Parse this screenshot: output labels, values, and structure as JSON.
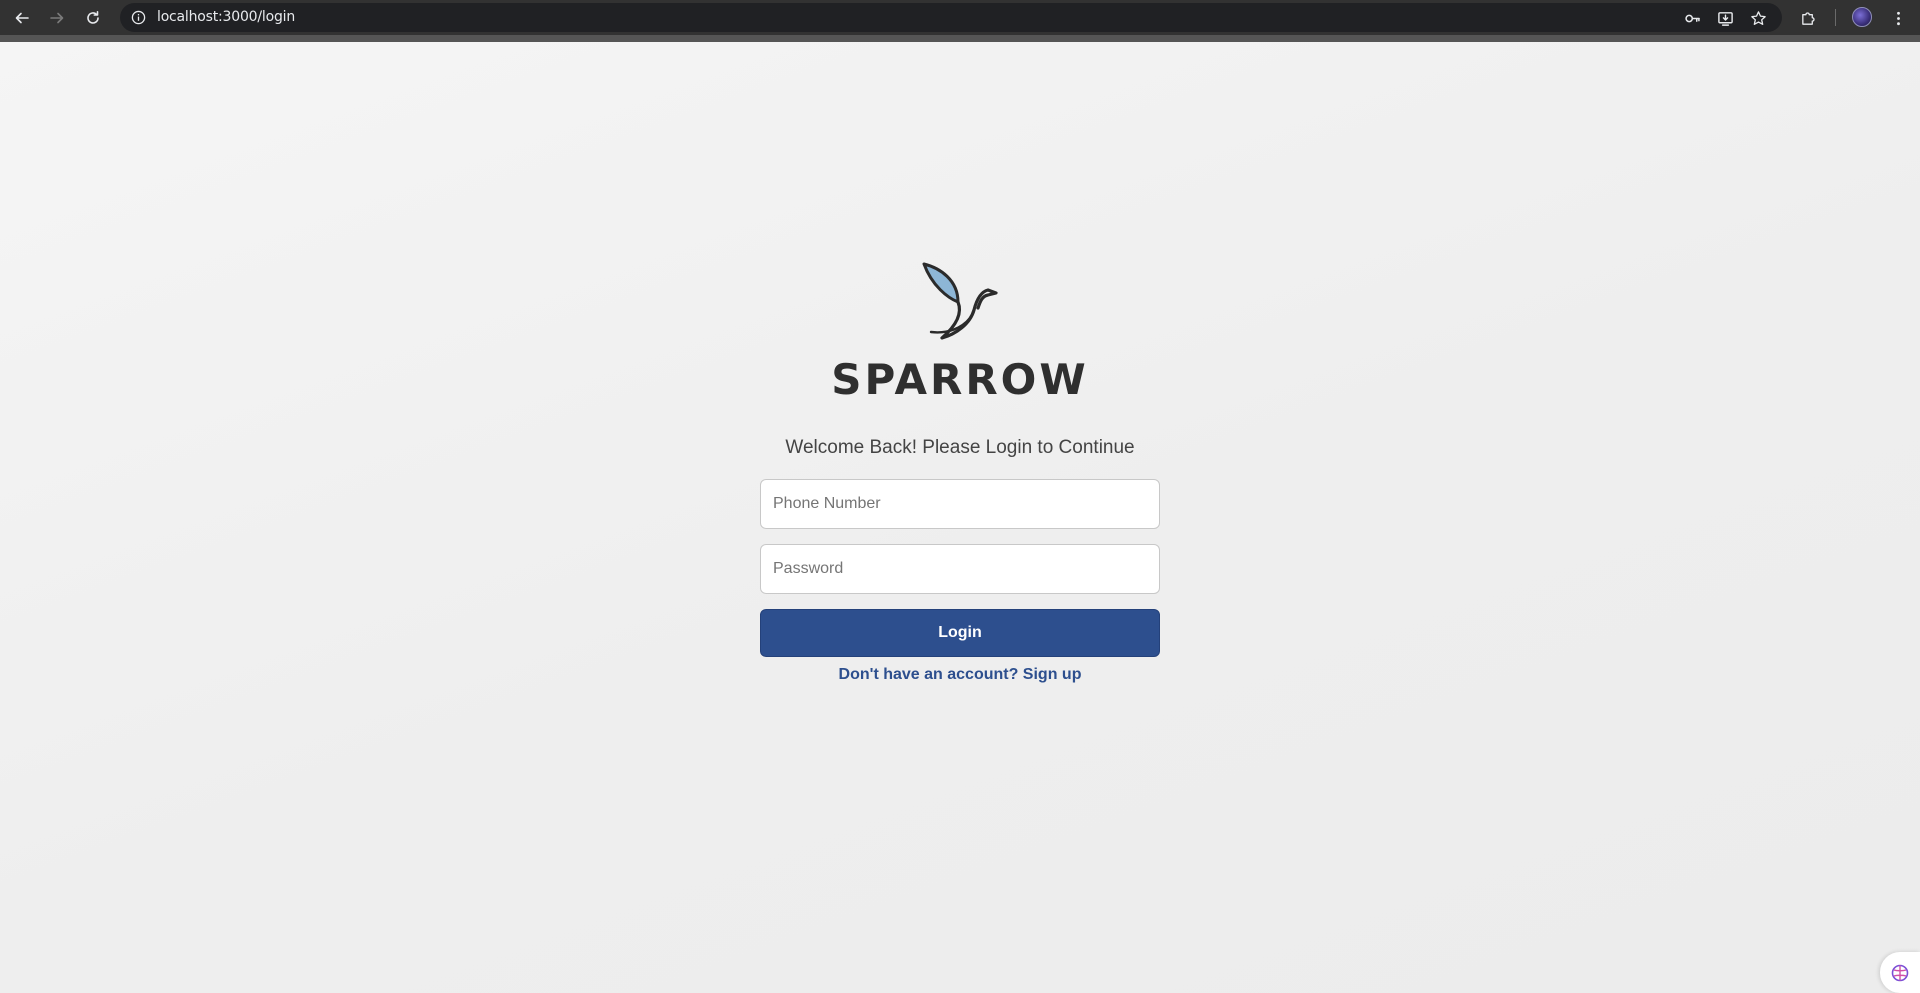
{
  "browser": {
    "url": "localhost:3000/login",
    "icons": {
      "back": "arrow-left-icon",
      "forward": "arrow-right-icon",
      "reload": "reload-icon",
      "site_info": "info-icon",
      "passwords": "key-icon",
      "install": "install-app-icon",
      "bookmark": "star-icon",
      "extensions": "puzzle-icon",
      "menu": "more-vert-icon"
    }
  },
  "login": {
    "brand": "SPARROW",
    "welcome": "Welcome Back! Please Login to Continue",
    "phone_placeholder": "Phone Number",
    "password_placeholder": "Password",
    "login_label": "Login",
    "signup_link": "Don't have an account? Sign up"
  },
  "colors": {
    "primary": "#2d4f8e",
    "brand_text": "#2f2f2f",
    "logo_wing": "#8db6d6",
    "logo_dark": "#2b2b2b",
    "page_bg": "#f0f0f0"
  }
}
